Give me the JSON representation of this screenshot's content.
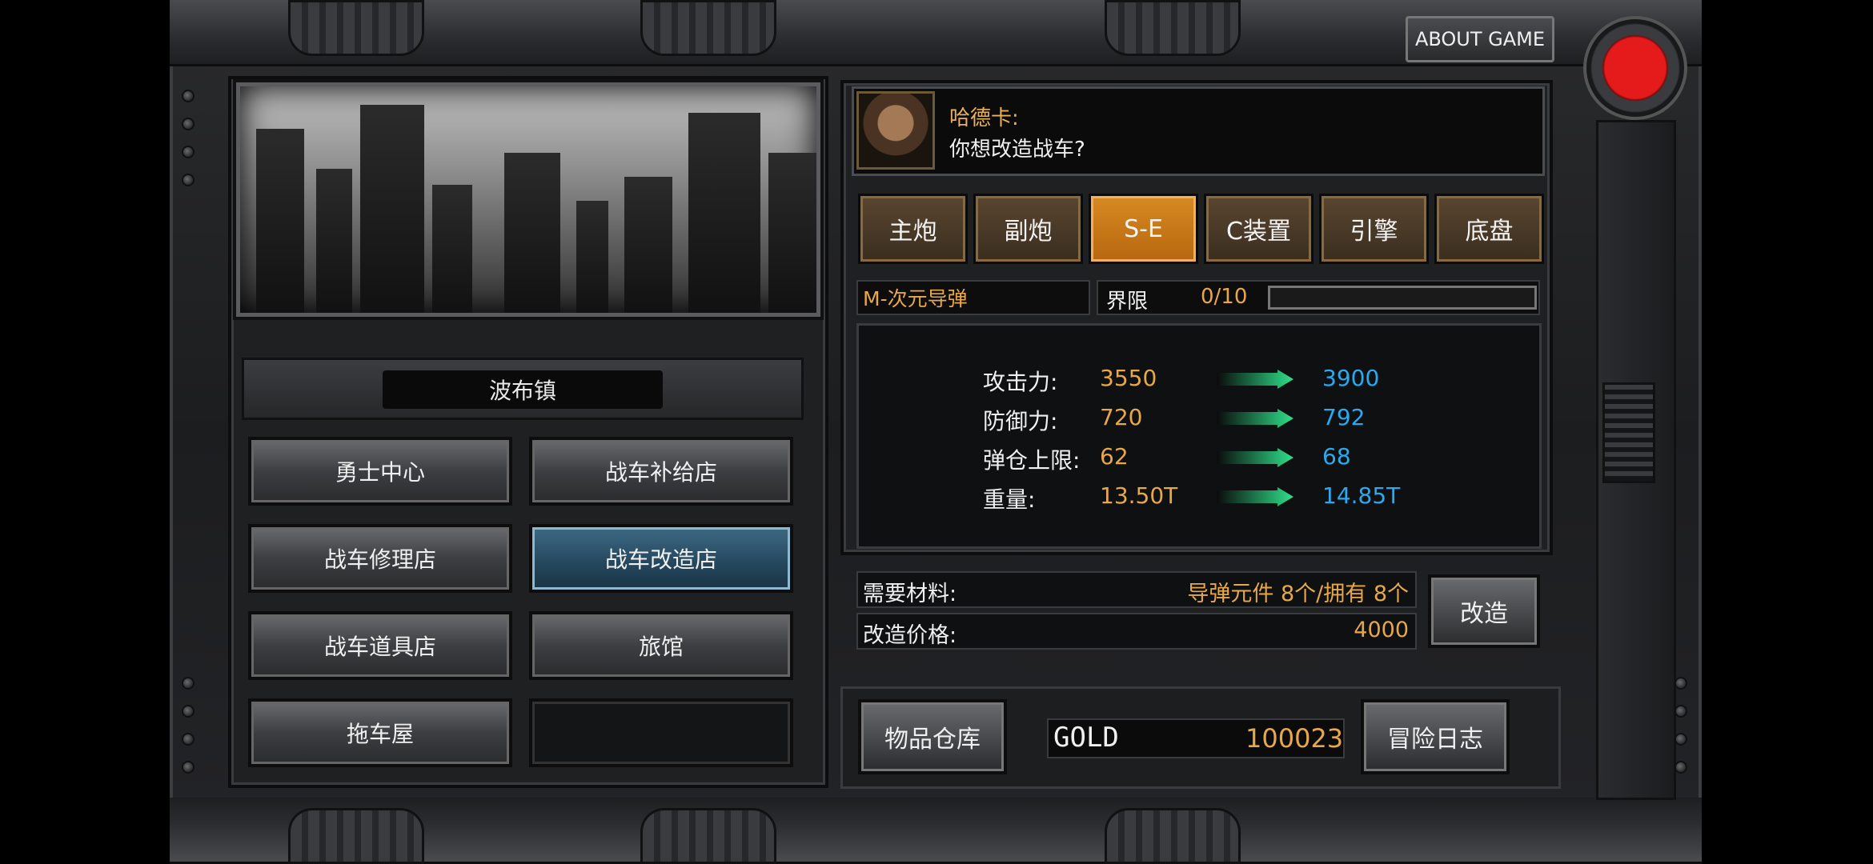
{
  "header": {
    "about_label": "ABOUT GAME"
  },
  "town": {
    "title": "波布镇",
    "buttons": [
      {
        "label": "勇士中心"
      },
      {
        "label": "战车补给店"
      },
      {
        "label": "战车修理店"
      },
      {
        "label": "战车改造店",
        "active": true
      },
      {
        "label": "战车道具店"
      },
      {
        "label": "旅馆"
      },
      {
        "label": "拖车屋"
      },
      {
        "label": ""
      }
    ]
  },
  "npc": {
    "name": "哈德卡:",
    "text": "你想改造战车?"
  },
  "tabs": [
    {
      "label": "主炮"
    },
    {
      "label": "副炮"
    },
    {
      "label": "S-E",
      "active": true
    },
    {
      "label": "C装置"
    },
    {
      "label": "引擎"
    },
    {
      "label": "底盘"
    }
  ],
  "item": {
    "name": "M-次元导弹",
    "limit_label": "界限",
    "limit_value": "0/10",
    "limit_fraction": 0.0
  },
  "stats": [
    {
      "label": "攻击力:",
      "old": "3550",
      "new": "3900"
    },
    {
      "label": "防御力:",
      "old": "720",
      "new": "792"
    },
    {
      "label": "弹仓上限:",
      "old": "62",
      "new": "68"
    },
    {
      "label": "重量:",
      "old": "13.50T",
      "new": "14.85T"
    }
  ],
  "materials": {
    "label": "需要材料:",
    "value": "导弹元件 8个/拥有 8个"
  },
  "price": {
    "label": "改造价格:",
    "value": "4000"
  },
  "upgrade_label": "改造",
  "footer": {
    "warehouse_label": "物品仓库",
    "gold_label": "GOLD",
    "gold_value": "100023",
    "log_label": "冒险日志"
  },
  "colors": {
    "accent_orange": "#d68a22",
    "active_blue": "#2a5a78",
    "value_orange": "#e7a84a",
    "value_blue": "#2aa9ef",
    "record_red": "#e51a1a"
  }
}
